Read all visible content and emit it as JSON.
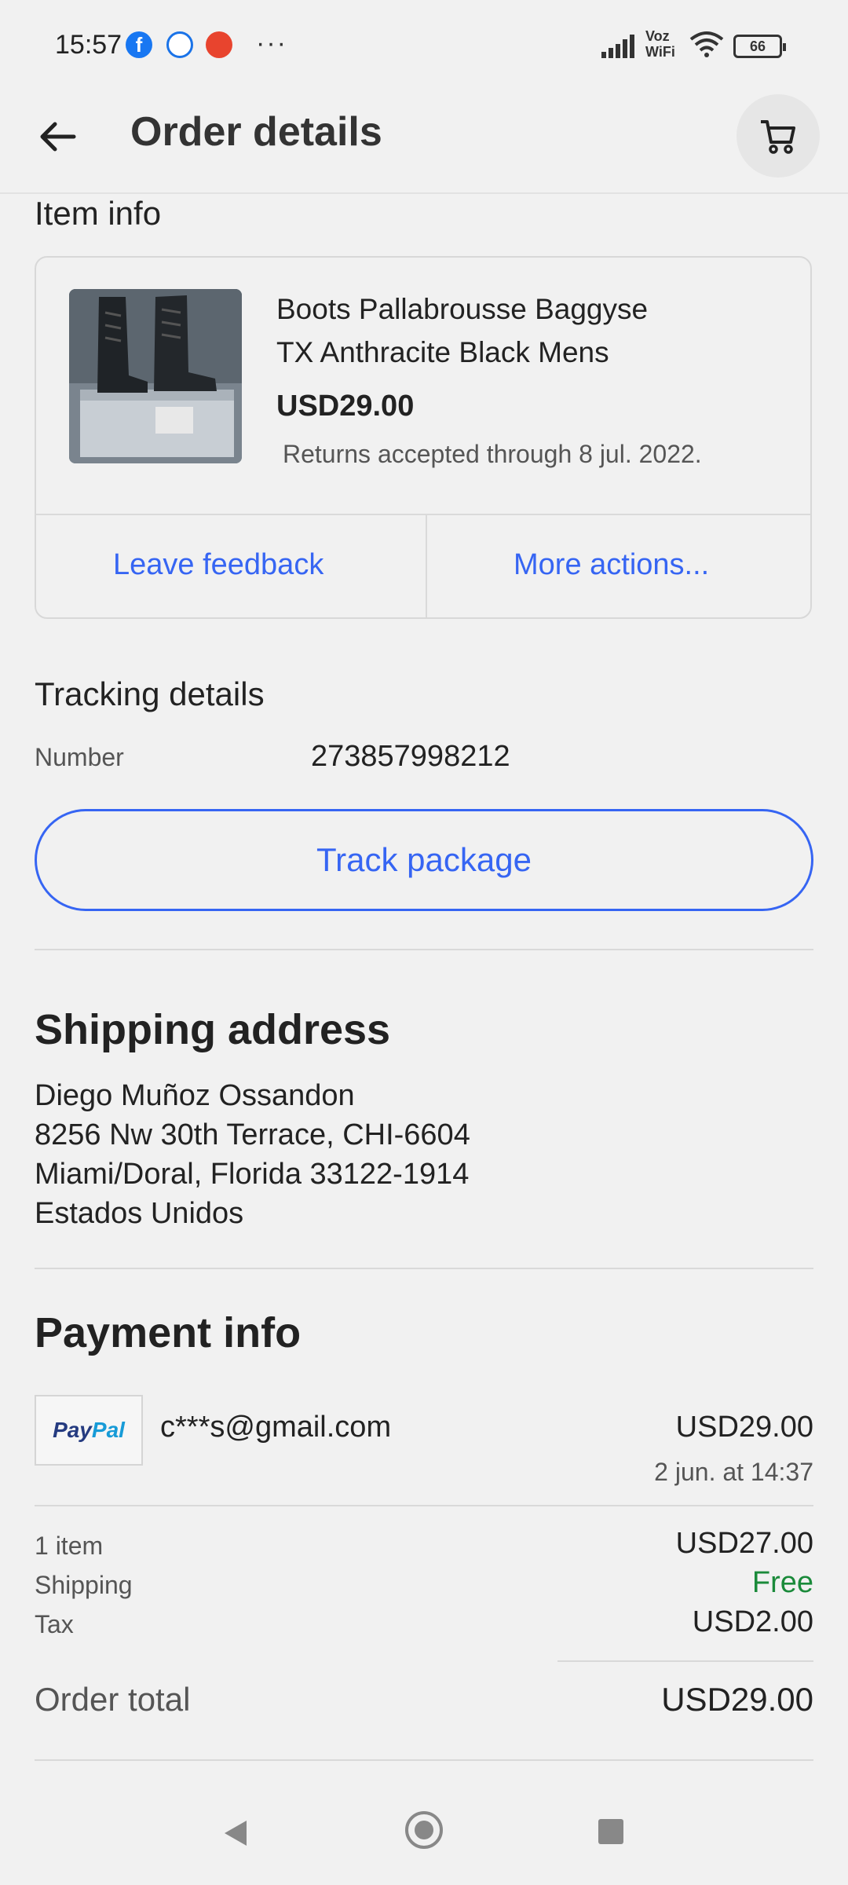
{
  "status_bar": {
    "time": "15:57",
    "dots": "···",
    "voz_wifi": "Voz WiFi",
    "battery": "66",
    "icons": [
      "facebook-icon",
      "messenger-icon",
      "aliexpress-icon",
      "signal-icon",
      "wifi-icon",
      "battery-icon"
    ]
  },
  "header": {
    "title": "Order details"
  },
  "item_info": {
    "heading": "Item info",
    "title_line1": "Boots Pallabrousse  Baggyse",
    "title_line2": "TX Anthracite Black Mens",
    "price": "USD29.00",
    "returns": "Returns accepted through 8 jul. 2022.",
    "leave_feedback": "Leave feedback",
    "more_actions": "More actions..."
  },
  "tracking": {
    "heading": "Tracking details",
    "number_label": "Number",
    "number_value": "273857998212",
    "track_button": "Track package"
  },
  "shipping": {
    "heading": "Shipping address",
    "lines": [
      "Diego Muñoz Ossandon",
      "8256 Nw 30th Terrace, CHI-6604",
      "Miami/Doral, Florida 33122-1914",
      "Estados Unidos"
    ]
  },
  "payment": {
    "heading": "Payment info",
    "paypal_logo_a": "Pay",
    "paypal_logo_b": "Pal",
    "email": "c***s@gmail.com",
    "amount": "USD29.00",
    "date": "2 jun. at 14:37",
    "items_label": "1 item",
    "items_value": "USD27.00",
    "shipping_label": "Shipping",
    "shipping_value": "Free",
    "tax_label": "Tax",
    "tax_value": "USD2.00",
    "total_label": "Order total",
    "total_value": "USD29.00"
  },
  "colors": {
    "link": "#3665f3",
    "free": "#1a8a3a",
    "background": "#f1f1f1"
  }
}
